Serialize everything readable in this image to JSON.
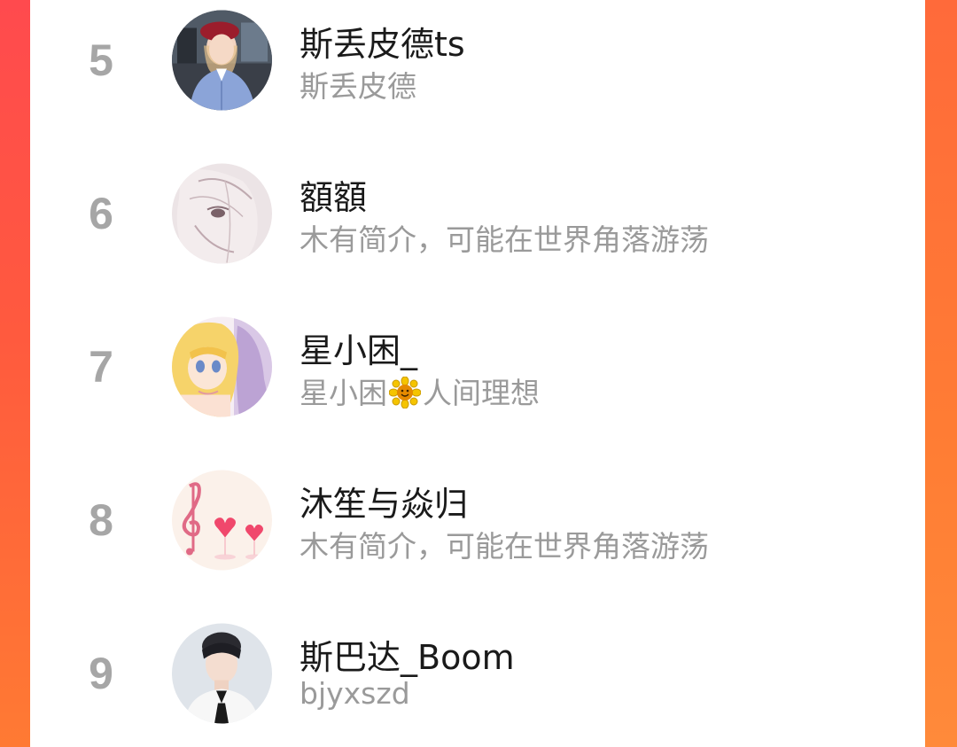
{
  "colors": {
    "background_accent": "#ff5a3e",
    "rank_color": "#a6a6a6",
    "name_color": "#1a1a1a",
    "desc_color": "#9a9a9a"
  },
  "users": [
    {
      "rank": "5",
      "name": "斯丢皮德ts",
      "desc": "斯丢皮德",
      "avatar_icon": "avatar-photo-woman-red-beret"
    },
    {
      "rank": "6",
      "name": "額額",
      "desc": "木有简介，可能在世界角落游荡",
      "avatar_icon": "avatar-sketch-anime-girl"
    },
    {
      "rank": "7",
      "name": "星小困_",
      "desc_pre": "星小困",
      "desc_emoji": "sunflower-emoji",
      "desc_post": "人间理想",
      "avatar_icon": "avatar-anime-blonde-girl"
    },
    {
      "rank": "8",
      "name": "沐笙与焱归",
      "desc": "木有简介，可能在世界角落游荡",
      "avatar_icon": "avatar-music-note-hearts"
    },
    {
      "rank": "9",
      "name": "斯巴达_Boom",
      "desc": "bjyxszd",
      "avatar_icon": "avatar-photo-man-white-shirt"
    }
  ]
}
